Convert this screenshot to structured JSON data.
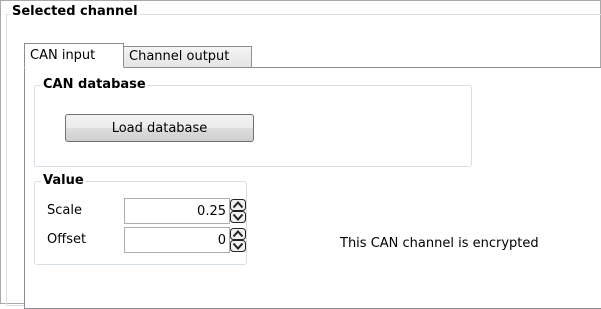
{
  "selected_channel": {
    "title": "Selected channel"
  },
  "tabs": [
    {
      "label": "CAN input",
      "active": true
    },
    {
      "label": "Channel output",
      "active": false
    }
  ],
  "can_database": {
    "title": "CAN database",
    "load_button_label": "Load database"
  },
  "value_group": {
    "title": "Value",
    "scale": {
      "label": "Scale",
      "value": "0.25"
    },
    "offset": {
      "label": "Offset",
      "value": "0"
    }
  },
  "status": {
    "encrypted_message": "This CAN channel is encrypted"
  },
  "icons": {
    "spinner_up": "chevron-up-icon",
    "spinner_down": "chevron-down-icon"
  }
}
